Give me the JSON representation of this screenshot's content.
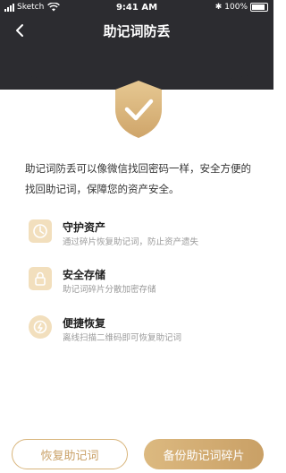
{
  "status_bar": {
    "carrier": "Sketch",
    "time": "9:41 AM",
    "battery": "100%"
  },
  "nav": {
    "back_icon": "chevron-left-icon",
    "title": "助记词防丢"
  },
  "hero": {
    "icon": "shield-check-icon"
  },
  "intro": {
    "text": "助记词防丢可以像微信找回密码一样，安全方便的找回助记词，保障您的资产安全。"
  },
  "features": [
    {
      "icon": "shield-guard-icon",
      "title": "守护资产",
      "desc": "通过碎片恢复助记词，防止资产遗失"
    },
    {
      "icon": "lock-storage-icon",
      "title": "安全存储",
      "desc": "助记词碎片分散加密存储"
    },
    {
      "icon": "clock-recover-icon",
      "title": "便捷恢复",
      "desc": "离线扫描二维码即可恢复助记词"
    }
  ],
  "actions": {
    "restore_label": "恢复助记词",
    "backup_label": "备份助记词碎片"
  },
  "colors": {
    "header_bg": "#2c2c30",
    "accent_gold": "#c9a066",
    "accent_gold_light": "#dcb980"
  }
}
